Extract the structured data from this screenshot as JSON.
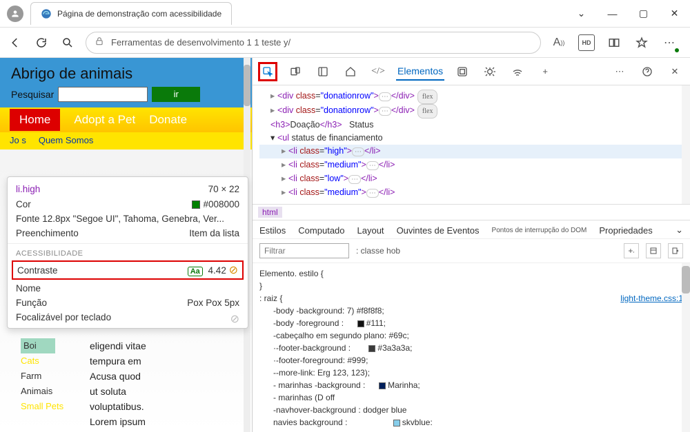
{
  "titlebar": {
    "tab_title": "Página de demonstração com acessibilidade"
  },
  "addressbar": {
    "url": "Ferramentas de desenvolvimento 1 1 teste y/"
  },
  "page": {
    "title": "Abrigo de animais",
    "search_label": "Pesquisar",
    "go_label": "ir",
    "nav": {
      "home": "Home",
      "adopt": "Adopt a Pet",
      "donate": "Donate"
    },
    "subnav": {
      "jos": "Jo s",
      "quem": "Quem Somos"
    },
    "sidebar": {
      "boi": "Boi",
      "cats": "Cats",
      "farm1": "Farm",
      "farm2": "Animais",
      "small": "Small Pets"
    },
    "body_lines": [
      "eligendi vitae",
      "tempura em",
      "Acusa quod",
      "ut soluta",
      "voluptatibus.",
      "Lorem ipsum"
    ]
  },
  "inspect": {
    "selector": "li.high",
    "dims": "70 × 22",
    "cor_label": "Cor",
    "cor_value": "#008000",
    "fonte_label": "Fonte 12.8px \"Segoe UI\", Tahoma, Genebra, Ver...",
    "preench_label": "Preenchimento",
    "preench_value": "Item da lista",
    "sect": "ACESSIBILIDADE",
    "contraste_label": "Contraste",
    "contraste_aa": "Aa",
    "contraste_value": "4.42",
    "nome_label": "Nome",
    "funcao_label": "Função",
    "funcao_value": "Pox Pox 5px",
    "focalizavel_label": "Focalizável por teclado"
  },
  "devtools": {
    "elements_label": "Elementos",
    "dom": {
      "line1_open": "<div class=\"donationrow\">",
      "line1_close": "</div>",
      "flex": "flex",
      "line2_open": "<div class=\"donationrow\">",
      "line3": "<h3>Doação</h3>",
      "status": "Status",
      "ul_open": "<ul",
      "ul_text": "status de financiamento",
      "li_high": "<li class=\"high\">",
      "li_med": "<li class=\"medium\">",
      "li_low": "<li class=\"low\">",
      "li_close": "</li>"
    },
    "breadcrumb": "html",
    "tabs": {
      "estilos": "Estilos",
      "computado": "Computado",
      "layout": "Layout",
      "ouvintes": "Ouvintes de Eventos",
      "pontos": "Pontos de interrupção do DOM",
      "props": "Propriedades"
    },
    "filter_placeholder": "Filtrar",
    "cls_label": ": classe hob",
    "styles": {
      "elem_label": "Elemento. estilo {",
      "close": "}",
      "raiz": ": raiz {",
      "link": "light-theme.css:1",
      "l1": "-body -background: 7) #f8f8f8;",
      "l2": "-body -foreground :",
      "l2v": "#111;",
      "l3": "-cabeçalho em segundo plano: #69c;",
      "l4": "·-footer-background :",
      "l4v": "#3a3a3a;",
      "l5": "·-footer-foreground: #999;",
      "l6": "--more-link:        Erg 123, 123);",
      "l7": "- marinhas -background :",
      "l7v": "Marinha;",
      "l8": "- marinhas (D off",
      "l9": "-navhover-background : dodger blue",
      "l10": "navies background :",
      "l10v": "skvblue:"
    }
  }
}
